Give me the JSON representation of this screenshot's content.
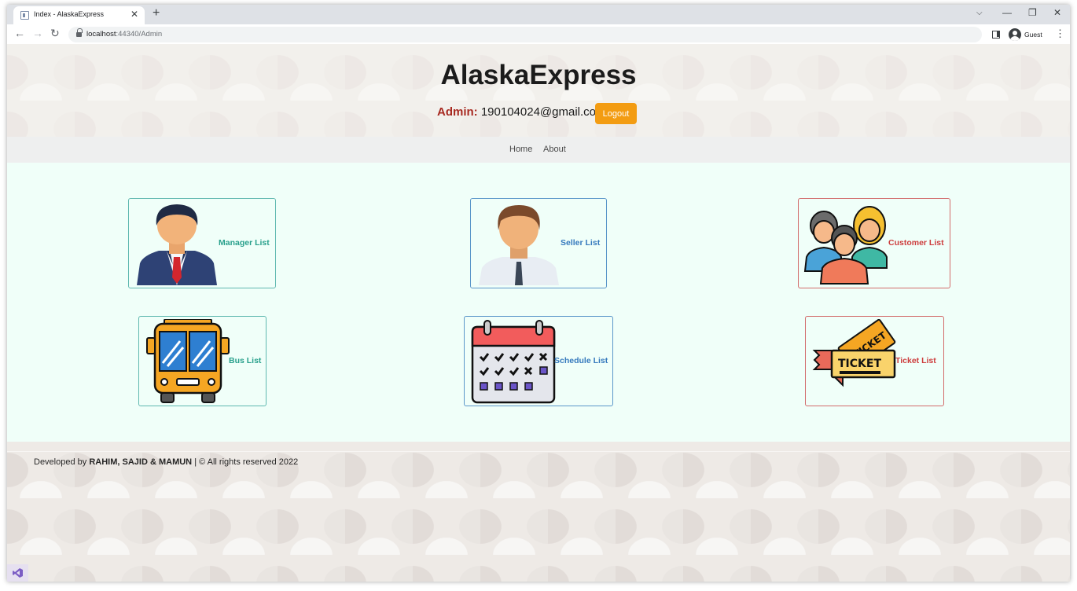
{
  "browser": {
    "tab_title": "Index - AlaskaExpress",
    "url_host": "localhost",
    "url_rest": ":44340/Admin",
    "profile_label": "Guest"
  },
  "header": {
    "site_title": "AlaskaExpress",
    "admin_label": "Admin:",
    "admin_email": "190104024@gmail.com",
    "logout_label": "Logout"
  },
  "nav": {
    "home": "Home",
    "about": "About"
  },
  "cards": {
    "manager": "Manager List",
    "seller": "Seller List",
    "customer": "Customer List",
    "bus": "Bus List",
    "schedule": "Schedule List",
    "ticket": "Ticket List"
  },
  "colors": {
    "teal": "#28a08c",
    "blue": "#3579bd",
    "red": "#cd3c3c",
    "orange": "#f39c12",
    "admin_red": "#a72920",
    "content_bg": "#f0fff9"
  },
  "footer": {
    "prefix": "Developed by",
    "authors": "RAHIM, SAJID & MAMUN",
    "suffix": "| © All rights reserved 2022"
  }
}
